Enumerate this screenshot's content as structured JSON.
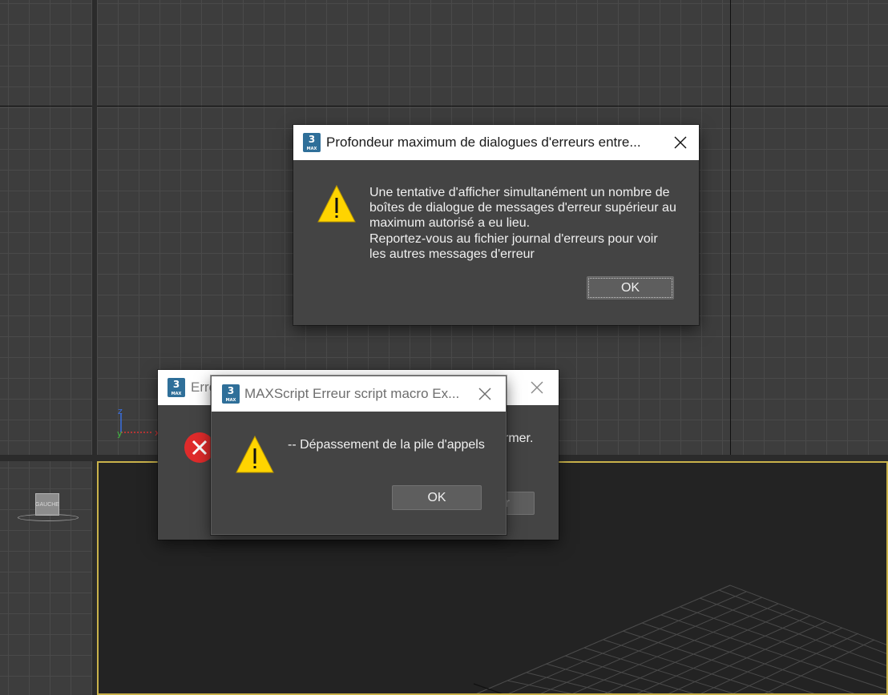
{
  "colors": {
    "viewport_bg": "#3d3d3d",
    "perspective_bg": "#232323",
    "active_border": "#c9b24a",
    "dialog_bg": "#444444",
    "titlebar_bg": "#ffffff",
    "warning_yellow": "#ffd400",
    "error_red": "#e02b2b"
  },
  "viewcube": {
    "label": "GAUCHE"
  },
  "dialogs": {
    "max_depth": {
      "title": "Profondeur maximum de dialogues d'erreurs entre...",
      "message_lines": [
        "Une tentative d'afficher simultanément un nombre de",
        "boîtes de dialogue de messages d'erreur supérieur au",
        "maximum autorisé a eu lieu.",
        "Reportez-vous au fichier journal d'erreurs pour voir",
        "les autres messages d'erreur"
      ],
      "ok_label": "OK",
      "icon": "warning-icon"
    },
    "error_behind": {
      "title_fragment": "Erre",
      "message_fragment": "rmer.",
      "button_fragment": "r",
      "icon": "error-icon"
    },
    "maxscript": {
      "title": "MAXScript Erreur script macro Ex...",
      "message": "-- Dépassement de la pile d'appels",
      "ok_label": "OK",
      "icon": "warning-icon"
    }
  }
}
